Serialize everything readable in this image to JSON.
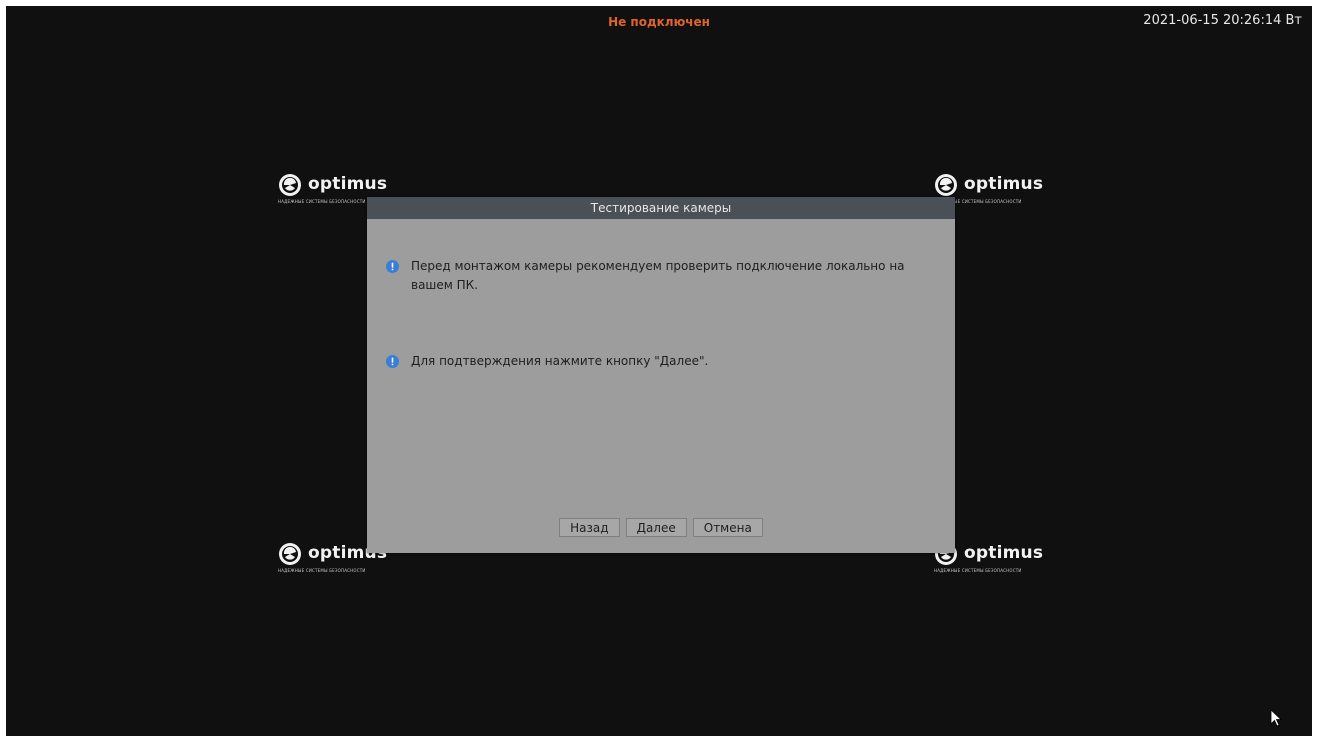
{
  "status": {
    "text": "Не подключен",
    "color": "#e0632b"
  },
  "datetime": "2021-06-15 20:26:14 Вт",
  "logo": {
    "brand": "optimus",
    "tagline": "НАДЕЖНЫЕ СИСТЕМЫ БЕЗОПАСНОСТИ",
    "icon": "optimus-logo-icon"
  },
  "dialog": {
    "title": "Тестирование камеры",
    "messages": [
      "Перед монтажом камеры рекомендуем проверить подключение локально на вашем ПК.",
      "Для подтверждения нажмите кнопку \"Далее\"."
    ],
    "buttons": {
      "back": "Назад",
      "next": "Далее",
      "cancel": "Отмена"
    },
    "info_icon": "info-icon",
    "info_color": "#3a7fd6"
  },
  "colors": {
    "screen_bg": "#101010",
    "dialog_bg": "#9d9d9d",
    "titlebar_bg": "#4b5056"
  }
}
